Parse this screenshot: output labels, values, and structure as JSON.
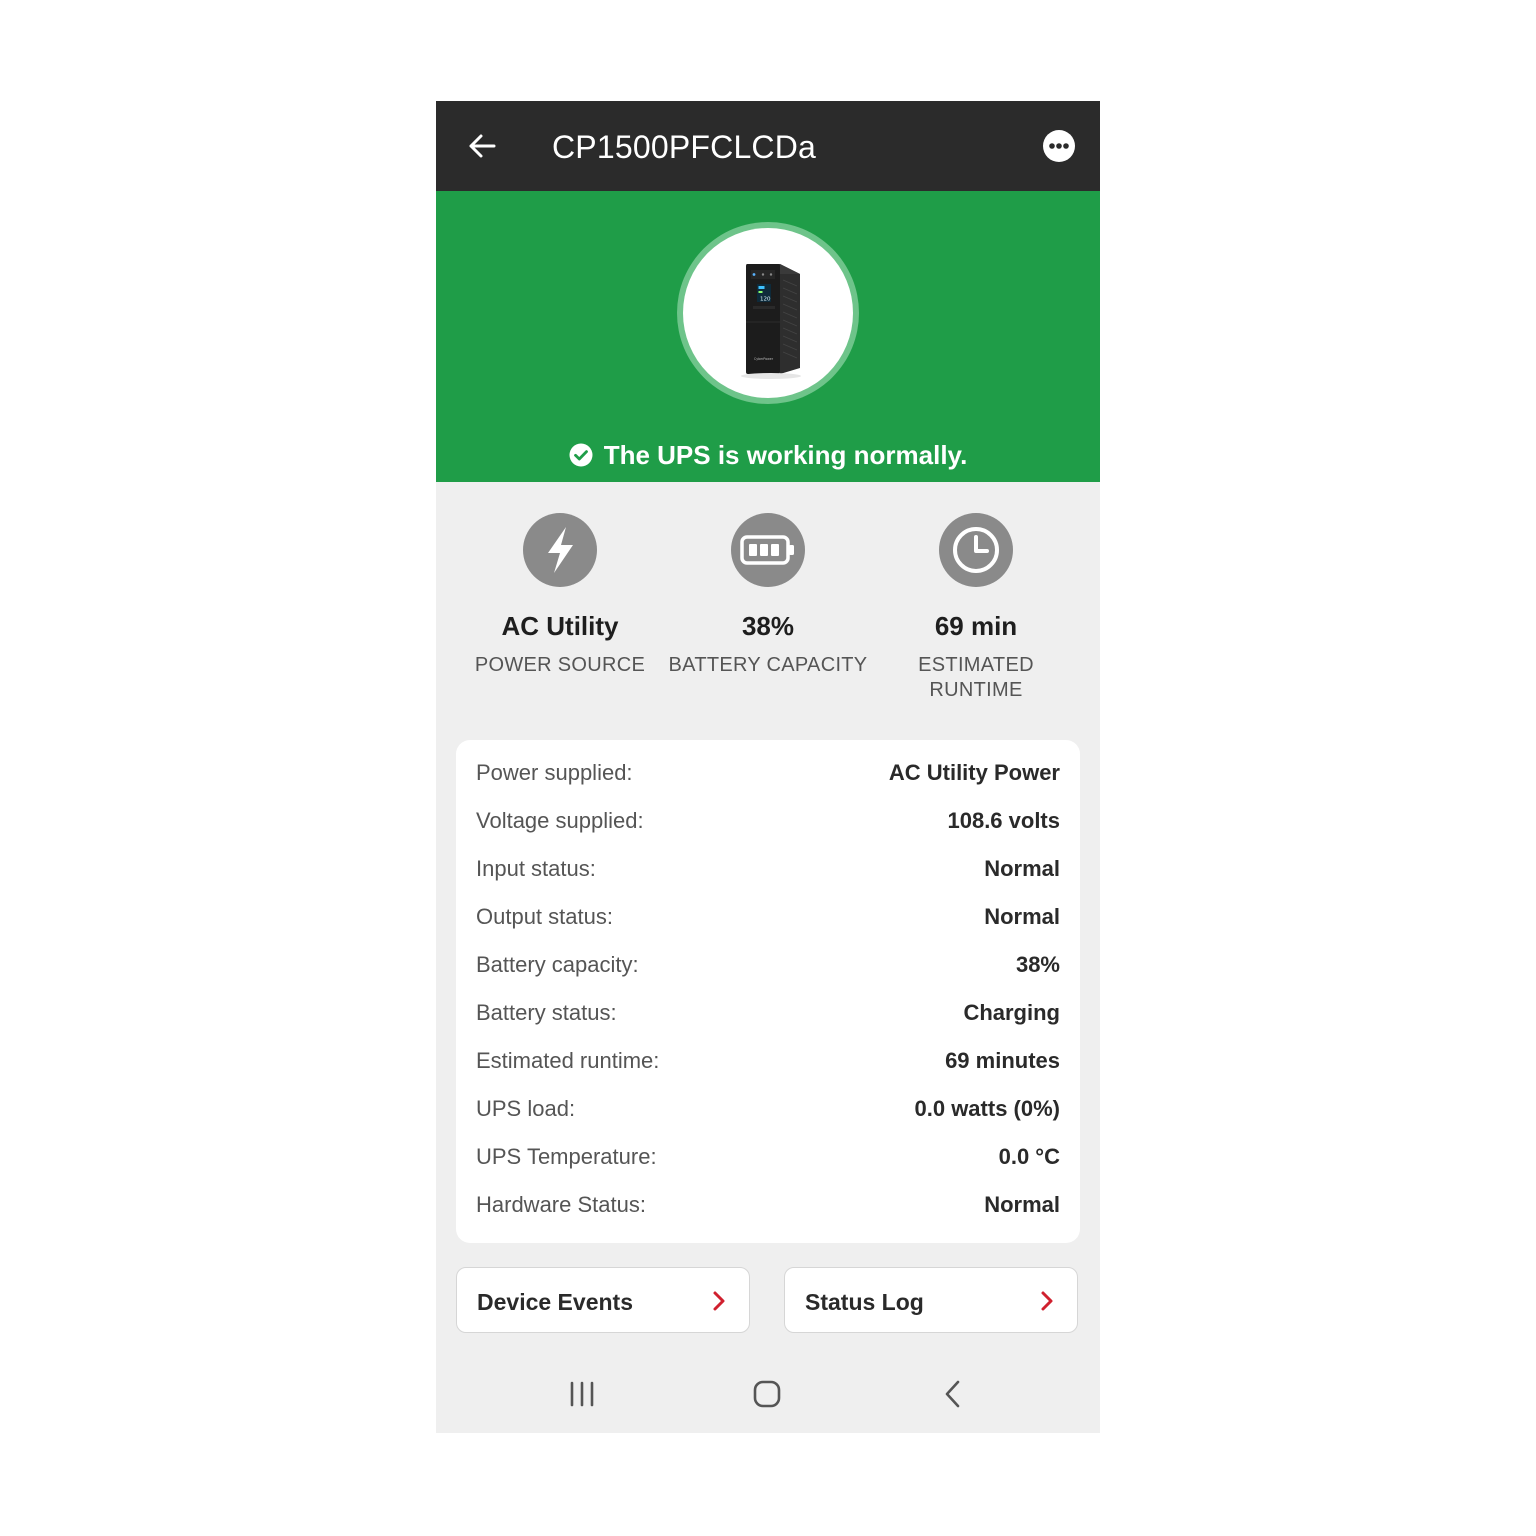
{
  "appbar": {
    "title": "CP1500PFCLCDa"
  },
  "hero": {
    "status_message": "The UPS is working normally.",
    "device_brand_label": "CyberPower",
    "device_screen_value": "120"
  },
  "stats": [
    {
      "value": "AC Utility",
      "label": "POWER SOURCE",
      "icon": "lightning-icon"
    },
    {
      "value": "38%",
      "label": "BATTERY CAPACITY",
      "icon": "battery-icon",
      "level": 0.38
    },
    {
      "value": "69 min",
      "label": "ESTIMATED RUNTIME",
      "icon": "clock-icon"
    }
  ],
  "details": [
    {
      "label": "Power supplied:",
      "value": "AC Utility Power"
    },
    {
      "label": "Voltage supplied:",
      "value": "108.6 volts"
    },
    {
      "label": "Input status:",
      "value": "Normal"
    },
    {
      "label": "Output status:",
      "value": "Normal"
    },
    {
      "label": "Battery capacity:",
      "value": "38%"
    },
    {
      "label": "Battery status:",
      "value": "Charging"
    },
    {
      "label": "Estimated runtime:",
      "value": "69 minutes"
    },
    {
      "label": "UPS load:",
      "value": "0.0 watts (0%)"
    },
    {
      "label": "UPS Temperature:",
      "value": "0.0 °C"
    },
    {
      "label": "Hardware Status:",
      "value": "Normal"
    }
  ],
  "buttons": {
    "device_events": "Device Events",
    "status_log": "Status Log"
  },
  "colors": {
    "header": "#2b2b2b",
    "hero_green": "#1f9d48",
    "accent_red": "#d0202e",
    "icon_gray": "#8a8a8a"
  }
}
